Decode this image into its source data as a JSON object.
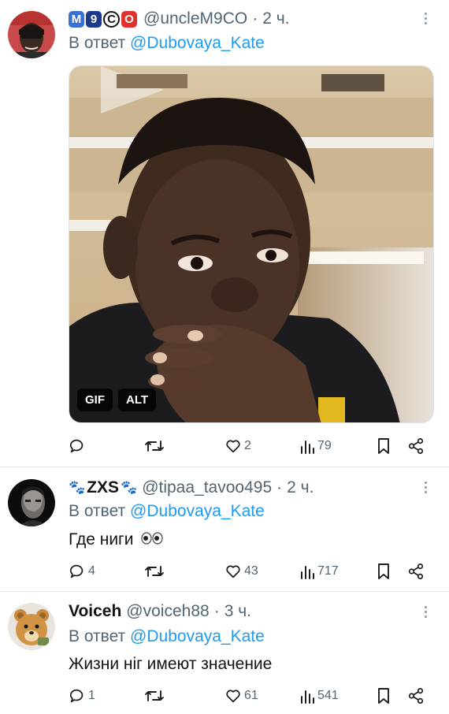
{
  "tweets": [
    {
      "badges": [
        "M",
        "9",
        "C",
        "O"
      ],
      "display_name": "",
      "handle": "@uncleM9CO",
      "time": "2 ч.",
      "reply_prefix": "В ответ",
      "reply_to": "@Dubovaya_Kate",
      "text": "",
      "media": {
        "kind": "gif",
        "gif_label": "GIF",
        "alt_label": "ALT",
        "description_icon": "meme-gif-image"
      },
      "stats": {
        "replies": "",
        "retweets": "",
        "likes": "2",
        "views": "79"
      }
    },
    {
      "display_name": "ZXS",
      "name_decoration": "paw-prints",
      "handle": "@tipaa_tavoo495",
      "time": "2 ч.",
      "reply_prefix": "В ответ",
      "reply_to": "@Dubovaya_Kate",
      "text": "Где ниги",
      "text_emoji": "eyes-emoji",
      "stats": {
        "replies": "4",
        "retweets": "",
        "likes": "43",
        "views": "717"
      }
    },
    {
      "display_name": "Voiceh",
      "handle": "@voiceh88",
      "time": "3 ч.",
      "reply_prefix": "В ответ",
      "reply_to": "@Dubovaya_Kate",
      "text": "Жизни ніг имеют значение",
      "stats": {
        "replies": "1",
        "retweets": "",
        "likes": "61",
        "views": "541"
      }
    }
  ],
  "colors": {
    "accent": "#1d9bf0",
    "secondary_text": "#536471",
    "primary_text": "#0f1419",
    "divider": "#e3e7ea",
    "badge_m": "#3b6fd4",
    "badge_9": "#1d3a8a",
    "badge_c": "#111111",
    "badge_o": "#e0312b"
  },
  "icons": [
    "reply-icon",
    "retweet-icon",
    "like-icon",
    "views-icon",
    "bookmark-icon",
    "share-icon",
    "more-icon"
  ]
}
